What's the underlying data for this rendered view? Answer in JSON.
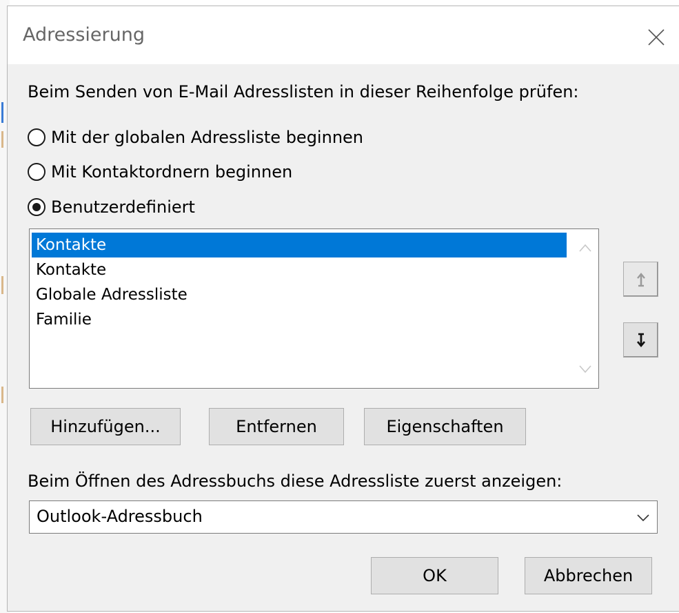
{
  "dialog": {
    "title": "Adressierung",
    "close_icon": "close-icon"
  },
  "search_order": {
    "heading": "Beim Senden von E-Mail Adresslisten in dieser Reihenfolge prüfen:",
    "options": [
      {
        "label": "Mit der globalen Adressliste beginnen",
        "checked": false
      },
      {
        "label": "Mit Kontaktordnern beginnen",
        "checked": false
      },
      {
        "label": "Benutzerdefiniert",
        "checked": true
      }
    ]
  },
  "address_lists": {
    "items": [
      {
        "label": "Kontakte",
        "selected": true
      },
      {
        "label": "Kontakte",
        "selected": false
      },
      {
        "label": "Globale Adressliste",
        "selected": false
      },
      {
        "label": "Familie",
        "selected": false
      }
    ],
    "scroll_up_icon": "chevron-up-icon",
    "scroll_down_icon": "chevron-down-icon"
  },
  "order_buttons": {
    "move_up_icon": "arrow-up-icon",
    "move_down_icon": "arrow-down-icon"
  },
  "list_actions": {
    "add_label": "Hinzufügen...",
    "remove_label": "Entfernen",
    "properties_label": "Eigenschaften"
  },
  "address_book": {
    "heading": "Beim Öffnen des Adressbuchs diese Adressliste zuerst anzeigen:",
    "selected_value": "Outlook-Adressbuch",
    "dropdown_icon": "chevron-down-icon"
  },
  "footer": {
    "ok_label": "OK",
    "cancel_label": "Abbrechen"
  },
  "colors": {
    "selection": "#0078d7",
    "dialog_background": "#f0f0f0",
    "button_face": "#e1e1e1"
  }
}
